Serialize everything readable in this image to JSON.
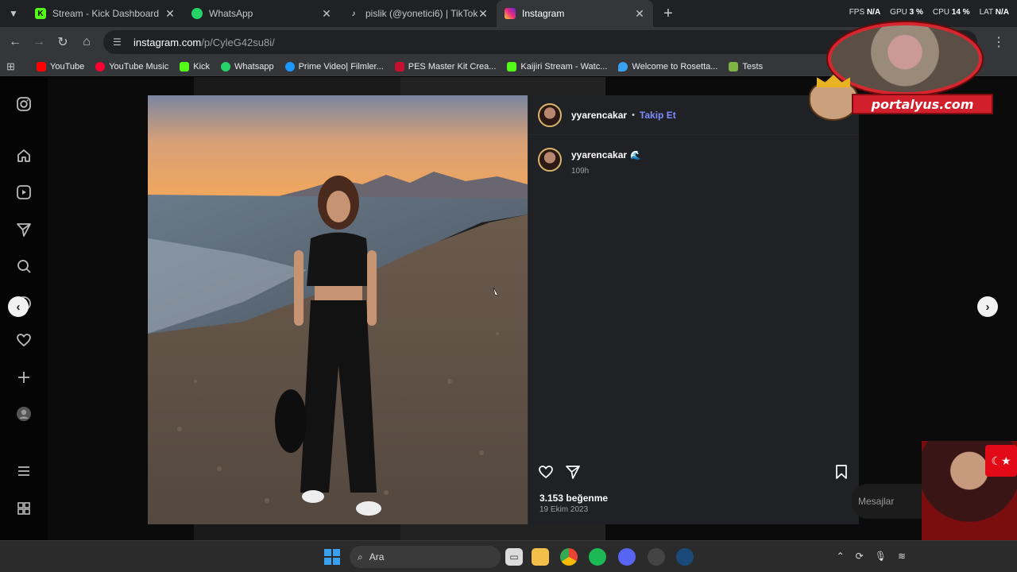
{
  "browser": {
    "tabs": [
      {
        "title": "Stream - Kick Dashboard",
        "icon": "kick-icon",
        "color": "#53fc18",
        "active": false
      },
      {
        "title": "WhatsApp",
        "icon": "whatsapp-icon",
        "color": "#25d366",
        "active": false
      },
      {
        "title": "pislik (@yonetici6) | TikTok",
        "icon": "tiktok-icon",
        "color": "#ffffff",
        "active": false
      },
      {
        "title": "Instagram",
        "icon": "instagram-icon",
        "color": "#e1306c",
        "active": true
      }
    ],
    "url_host": "instagram.com",
    "url_path": "/p/CyleG42su8i/",
    "bookmarks": [
      {
        "label": "YouTube",
        "color": "#ff0000"
      },
      {
        "label": "YouTube Music",
        "color": "#ff0033"
      },
      {
        "label": "Kick",
        "color": "#53fc18"
      },
      {
        "label": "Whatsapp",
        "color": "#25d366"
      },
      {
        "label": "Prime Video| Filmler...",
        "color": "#1a98ff"
      },
      {
        "label": "PES Master Kit Crea...",
        "color": "#c8102e"
      },
      {
        "label": "Kaijiri Stream - Watc...",
        "color": "#53fc18"
      },
      {
        "label": "Welcome to Rosetta...",
        "color": "#3aa0f0"
      },
      {
        "label": "Tests",
        "color": "#7cb342"
      }
    ]
  },
  "stats": {
    "fps_label": "FPS",
    "fps_value": "N/A",
    "gpu_label": "GPU",
    "gpu_value": "3 %",
    "cpu_label": "CPU",
    "cpu_value": "14 %",
    "lat_label": "LAT",
    "lat_value": "N/A"
  },
  "post": {
    "username": "yyarencakar",
    "follow_label": "Takip Et",
    "dot": "•",
    "comment_time": "109h",
    "likes": "3.153 beğenme",
    "date": "19 Ekim 2023"
  },
  "sidebar_messages": "Mesajlar",
  "overlay": {
    "brand": "portalyus.com"
  },
  "taskbar": {
    "search_label": "Ara"
  }
}
